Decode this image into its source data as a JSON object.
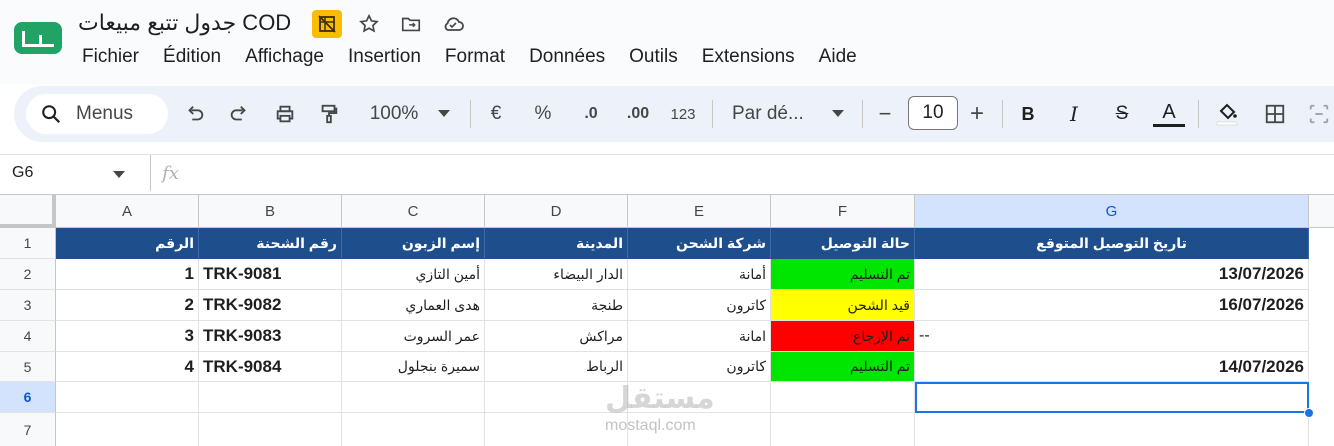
{
  "window": {
    "title": "جدول تتبع مبيعات COD"
  },
  "menubar": [
    "Fichier",
    "Édition",
    "Affichage",
    "Insertion",
    "Format",
    "Données",
    "Outils",
    "Extensions",
    "Aide"
  ],
  "toolbar": {
    "search_label": "Menus",
    "zoom": "100%",
    "currency": "€",
    "percent": "%",
    "dec_decrease": ".0",
    "dec_increase": ".00",
    "number_format": "123",
    "font_name": "Par dé...",
    "minus": "−",
    "font_size": "10",
    "plus": "+",
    "bold": "B",
    "italic": "I",
    "strike": "S",
    "text_color": "A"
  },
  "formula_bar": {
    "name_box": "G6",
    "fx": "fx"
  },
  "columns": [
    "A",
    "B",
    "C",
    "D",
    "E",
    "F",
    "G"
  ],
  "rows": [
    "1",
    "2",
    "3",
    "4",
    "5",
    "6",
    "7"
  ],
  "table": {
    "headers": [
      "الرقم",
      "رقم الشحنة",
      "إسم الزبون",
      "المدينة",
      "شركة الشحن",
      "حالة التوصيل",
      "تاريخ التوصيل المتوقع"
    ],
    "rows": [
      {
        "num": "1",
        "trk": "TRK-9081",
        "customer": "أمين التازي",
        "city": "الدار البيضاء",
        "carrier": "أمانة",
        "status": "تم التسليم",
        "status_color": "#00e600",
        "date": "13/07/2026"
      },
      {
        "num": "2",
        "trk": "TRK-9082",
        "customer": "هدى العماري",
        "city": "طنجة",
        "carrier": "كاترون",
        "status": "قيد الشحن",
        "status_color": "#ffff00",
        "date": "16/07/2026"
      },
      {
        "num": "3",
        "trk": "TRK-9083",
        "customer": "عمر السروت",
        "city": "مراكش",
        "carrier": "امانة",
        "status": "تم الإرجاع",
        "status_color": "#ff0000",
        "date": "--"
      },
      {
        "num": "4",
        "trk": "TRK-9084",
        "customer": "سميرة بنجلول",
        "city": "الرباط",
        "carrier": "كاترون",
        "status": "تم التسليم",
        "status_color": "#00e600",
        "date": "14/07/2026"
      }
    ]
  },
  "watermark": {
    "main": "مستقل",
    "sub": "mostaql.com"
  },
  "colors": {
    "header_bg": "#1f4e8c",
    "selection": "#1a73e8",
    "sheets_green": "#21a366"
  }
}
